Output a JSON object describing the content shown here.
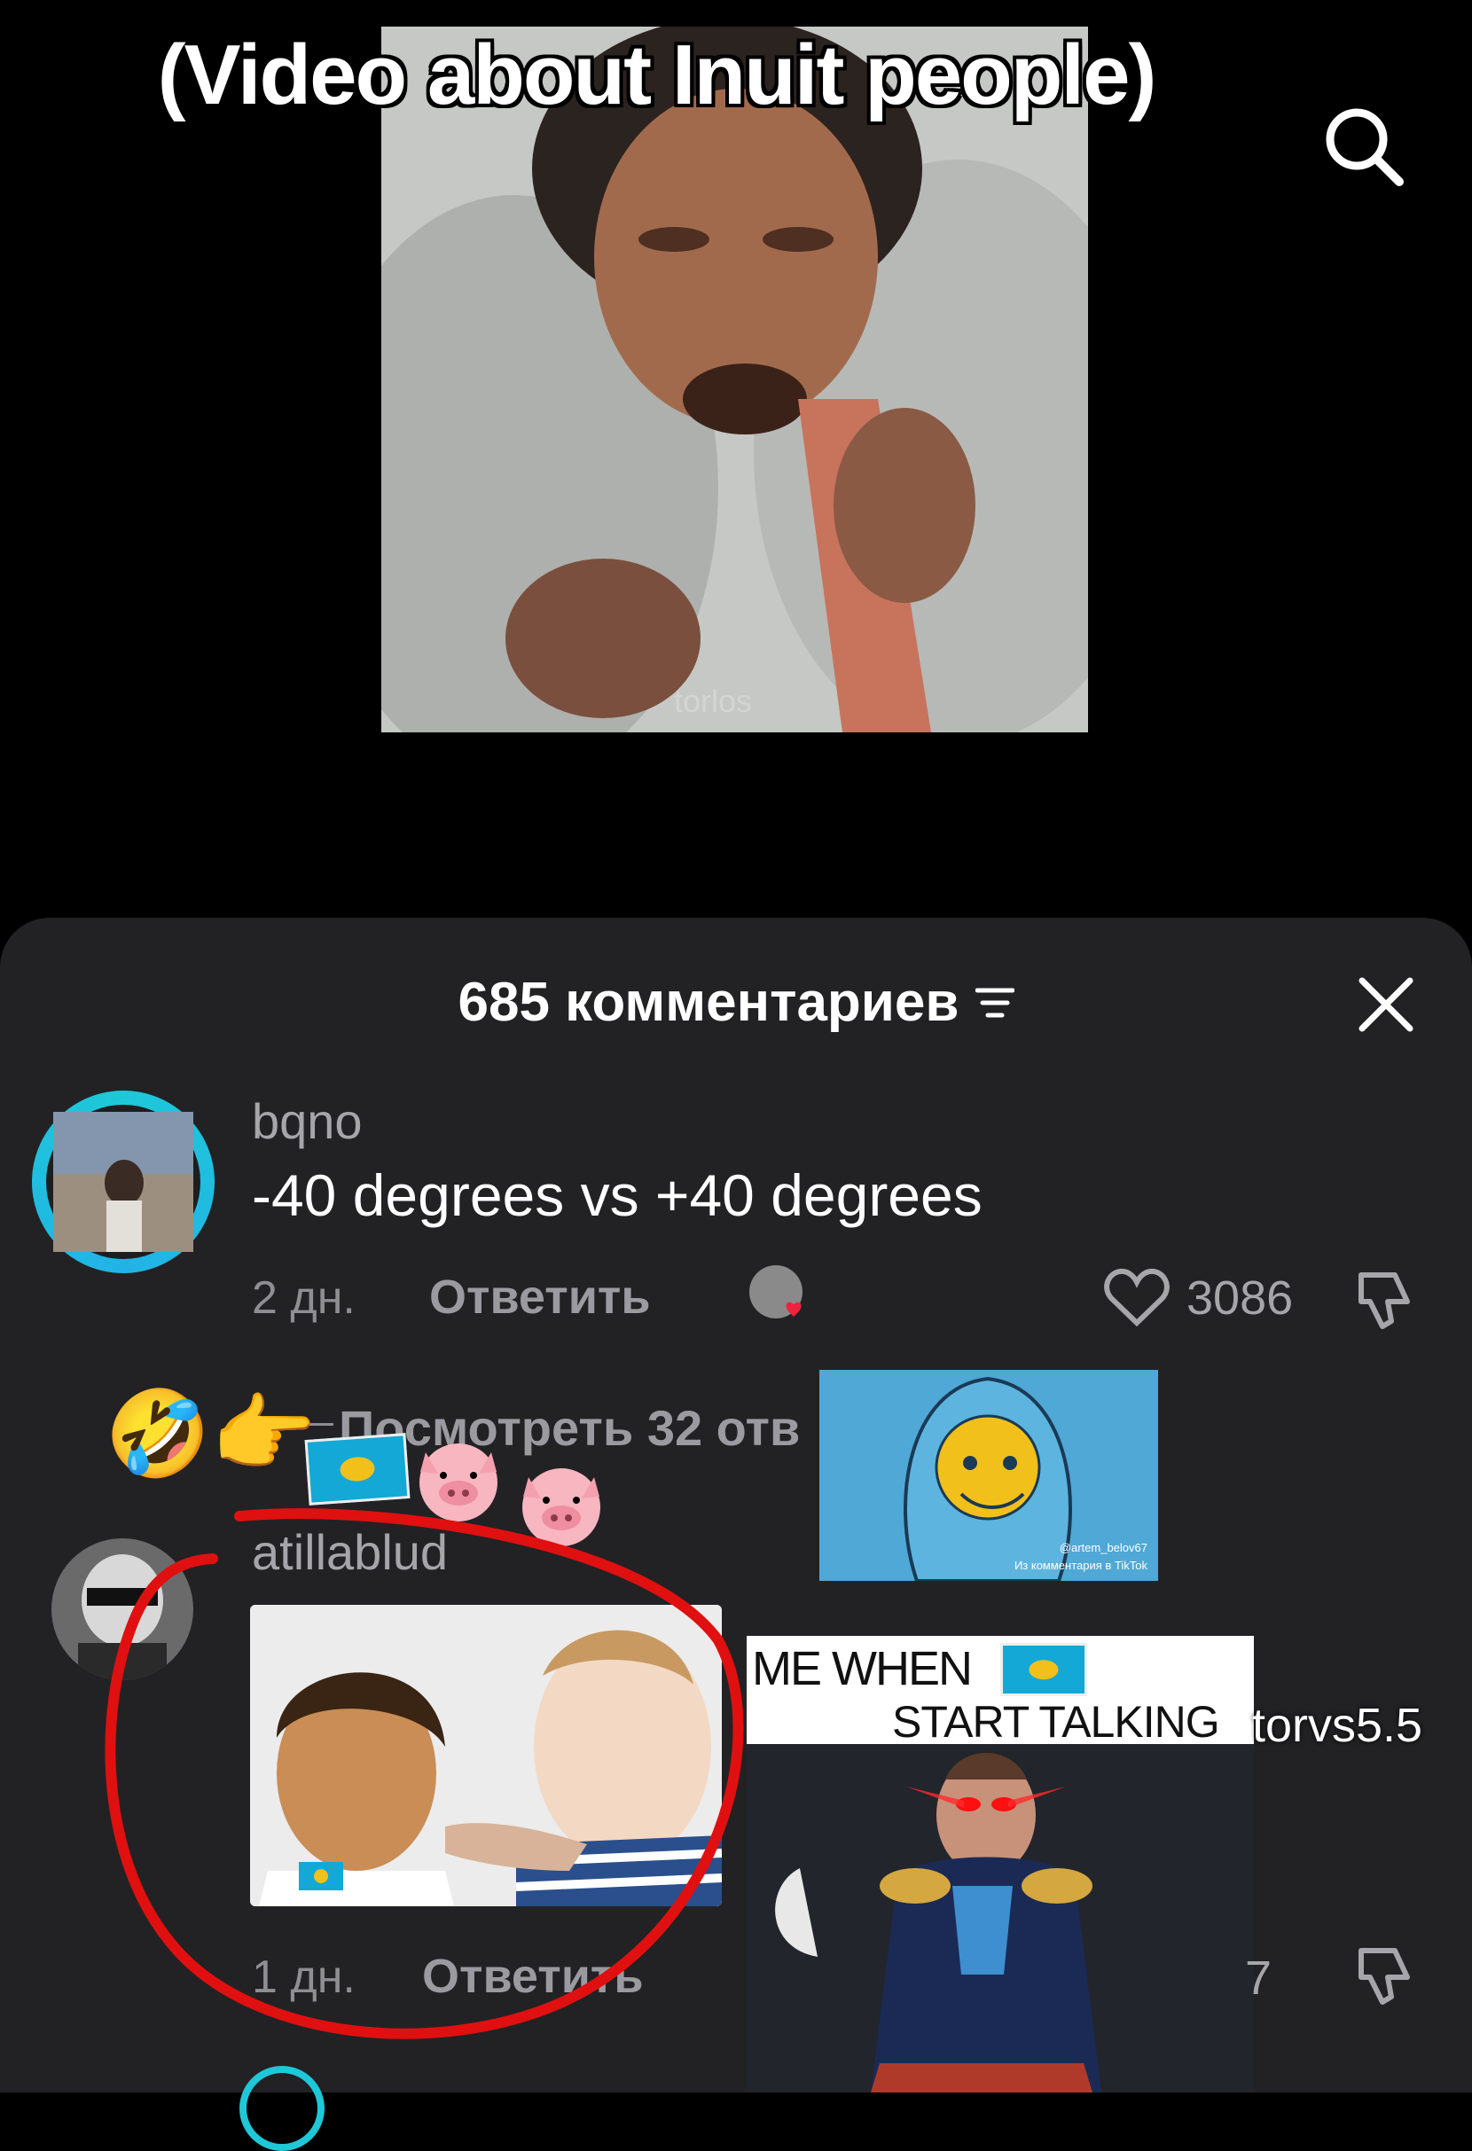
{
  "video": {
    "caption": "(Video about Inuit people)",
    "watermark": "torlos"
  },
  "comments_sheet": {
    "title": "685 комментариев",
    "comments": [
      {
        "username": "bqno",
        "text": "-40 degrees vs +40 degrees",
        "age": "2 дн.",
        "reply_label": "Ответить",
        "likes": "3086",
        "view_replies": "Посмотреть 32 отв"
      },
      {
        "username": "atillablud",
        "age": "1 дн.",
        "reply_label": "Ответить",
        "likes_partial": "7"
      }
    ]
  },
  "stickers": {
    "meme1_credit": "@artem_belov67",
    "meme1_footer": "Из комментария в TikTok",
    "meme3_line1": "ME WHEN",
    "meme3_line2": "START TALKING",
    "meme3_side": "torvs5.5",
    "emojis": "🤣👉"
  },
  "colors": {
    "sheet_bg": "#222224",
    "ring": "#1ec8d8",
    "annotation_red": "#e01010",
    "kz_flag_blue": "#13a8d6"
  },
  "icons": [
    "search-icon",
    "close-icon",
    "filter-icon",
    "heart-icon",
    "dislike-icon"
  ]
}
